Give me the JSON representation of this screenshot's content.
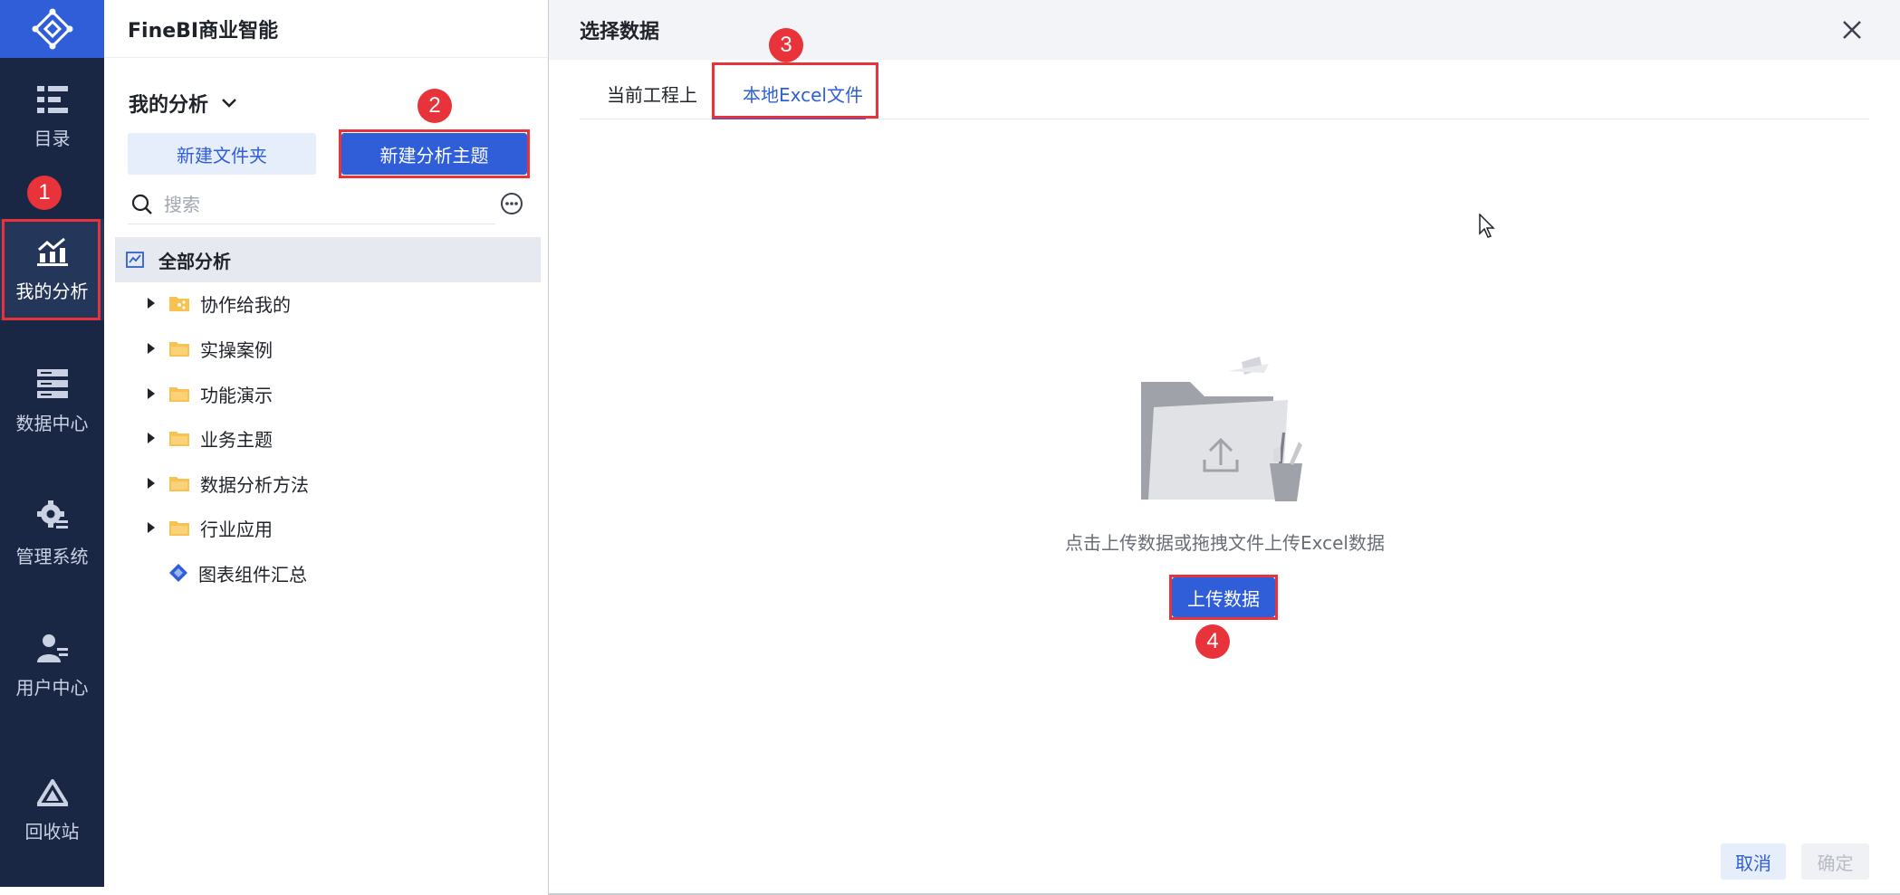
{
  "rail": {
    "items": [
      {
        "label": "目录",
        "icon": "catalog-icon"
      },
      {
        "label": "我的分析",
        "icon": "analysis-chart-icon",
        "active": true
      },
      {
        "label": "数据中心",
        "icon": "data-center-icon"
      },
      {
        "label": "管理系统",
        "icon": "settings-gear-icon"
      },
      {
        "label": "用户中心",
        "icon": "user-icon"
      },
      {
        "label": "回收站",
        "icon": "recycle-bin-icon"
      }
    ]
  },
  "app": {
    "title": "FineBI商业智能"
  },
  "panel": {
    "title": "我的分析",
    "new_folder": "新建文件夹",
    "new_topic": "新建分析主题",
    "search_placeholder": "搜索"
  },
  "tree": {
    "root": "全部分析",
    "items": [
      {
        "label": "协作给我的",
        "icon": "shared-folder-icon"
      },
      {
        "label": "实操案例",
        "icon": "folder-icon"
      },
      {
        "label": "功能演示",
        "icon": "folder-icon"
      },
      {
        "label": "业务主题",
        "icon": "folder-icon"
      },
      {
        "label": "数据分析方法",
        "icon": "folder-icon"
      },
      {
        "label": "行业应用",
        "icon": "folder-icon"
      },
      {
        "label": "图表组件汇总",
        "icon": "component-icon"
      }
    ]
  },
  "dialog": {
    "title": "选择数据",
    "tabs": [
      {
        "label": "当前工程上",
        "active": false
      },
      {
        "label": "本地Excel文件",
        "active": true
      }
    ],
    "hint": "点击上传数据或拖拽文件上传Excel数据",
    "upload": "上传数据",
    "cancel": "取消",
    "confirm": "确定"
  },
  "badges": [
    "1",
    "2",
    "3",
    "4"
  ],
  "colors": {
    "accent": "#2f5ed8",
    "rail": "#1a2744",
    "highlight": "#e8333a"
  }
}
